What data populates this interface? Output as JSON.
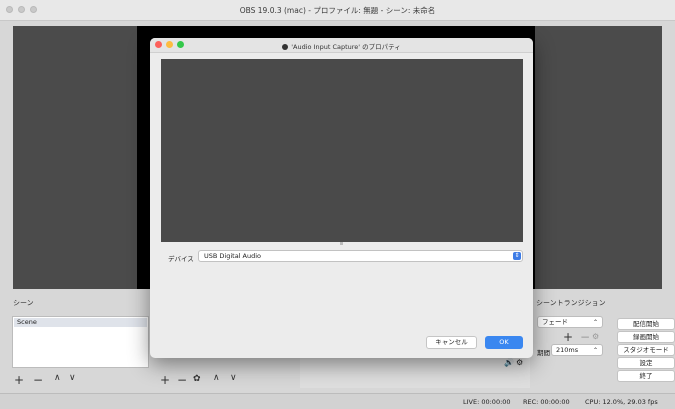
{
  "window": {
    "title": "OBS 19.0.3 (mac) - プロファイル: 無題 - シーン: 未命名"
  },
  "dialog": {
    "title": "'Audio Input Capture' のプロパティ",
    "device_label": "デバイス",
    "device_value": "USB Digital Audio",
    "cancel_label": "キャンセル",
    "ok_label": "OK"
  },
  "scenes": {
    "title": "シーン",
    "items": [
      "Scene"
    ],
    "toolbar": {
      "add": "+",
      "remove": "−",
      "up": "∧",
      "down": "∨"
    }
  },
  "sources": {
    "toolbar": {
      "add": "+",
      "remove": "−",
      "settings": "✿",
      "up": "∧",
      "down": "∨"
    }
  },
  "transitions": {
    "title": "シーントランジション",
    "selected": "フェード",
    "add": "+",
    "remove": "−",
    "duration_label": "期間",
    "duration_value": "210ms"
  },
  "controls": {
    "start_streaming": "配信開始",
    "start_recording": "録画開始",
    "studio_mode": "スタジオモード",
    "settings": "設定",
    "exit": "終了"
  },
  "status": {
    "live": "LIVE: 00:00:00",
    "rec": "REC: 00:00:00",
    "cpu": "CPU: 12.0%, 29.03 fps"
  },
  "colors": {
    "accent": "#3a87f0",
    "mixer_bar": "#4a7dd6",
    "close": "#fc605b",
    "minimize": "#fdbc40",
    "zoom": "#34c84a"
  }
}
